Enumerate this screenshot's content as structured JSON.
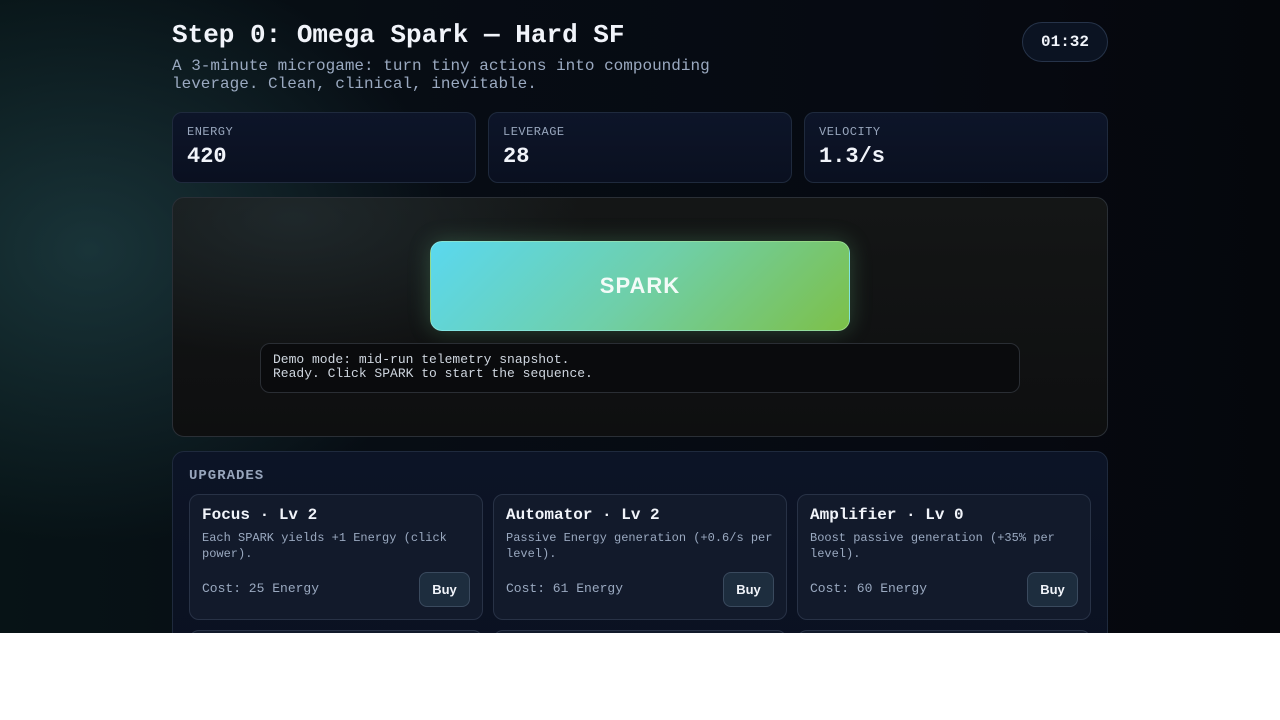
{
  "header": {
    "title": "Step 0: Omega Spark — Hard SF",
    "subtitle": "A 3-minute microgame: turn tiny actions into compounding leverage. Clean, clinical, inevitable.",
    "timer": "01:32"
  },
  "stats": [
    {
      "label": "ENERGY",
      "value": "420"
    },
    {
      "label": "LEVERAGE",
      "value": "28"
    },
    {
      "label": "VELOCITY",
      "value": "1.3/s"
    }
  ],
  "play": {
    "spark_label": "SPARK",
    "log": [
      "Demo mode: mid-run telemetry snapshot.",
      "Ready. Click SPARK to start the sequence."
    ]
  },
  "upgrades": {
    "title": "UPGRADES",
    "items": [
      {
        "title": "Focus · Lv 2",
        "desc": "Each SPARK yields +1 Energy (click power).",
        "cost": "Cost: 25 Energy",
        "buy_label": "Buy"
      },
      {
        "title": "Automator · Lv 2",
        "desc": "Passive Energy generation (+0.6/s per level).",
        "cost": "Cost: 61 Energy",
        "buy_label": "Buy"
      },
      {
        "title": "Amplifier · Lv 0",
        "desc": "Boost passive generation (+35% per level).",
        "cost": "Cost: 60 Energy",
        "buy_label": "Buy"
      }
    ]
  },
  "colors": {
    "spark_gradient_start": "#5ad8ef",
    "spark_gradient_end": "#7dc048",
    "background": "#060a12"
  }
}
